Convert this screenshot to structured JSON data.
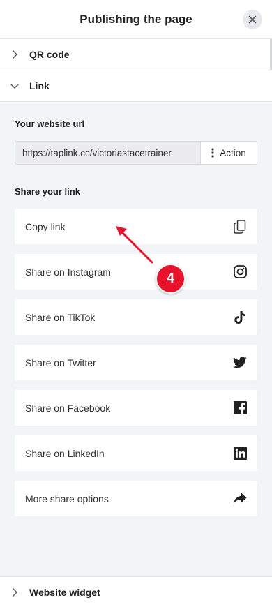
{
  "header": {
    "title": "Publishing the page"
  },
  "accordion": {
    "qr_label": "QR code",
    "link_label": "Link",
    "widget_label": "Website widget"
  },
  "link_panel": {
    "url_label": "Your website url",
    "url_value": "https://taplink.cc/victoriastacetrainer",
    "action_label": "Action",
    "share_label": "Share your link",
    "share_items": [
      {
        "label": "Copy link",
        "icon": "copy-icon"
      },
      {
        "label": "Share on Instagram",
        "icon": "instagram-icon"
      },
      {
        "label": "Share on TikTok",
        "icon": "tiktok-icon"
      },
      {
        "label": "Share on Twitter",
        "icon": "twitter-icon"
      },
      {
        "label": "Share on Facebook",
        "icon": "facebook-icon"
      },
      {
        "label": "Share on LinkedIn",
        "icon": "linkedin-icon"
      },
      {
        "label": "More share options",
        "icon": "share-arrow-icon"
      }
    ]
  },
  "annotation": {
    "step": "4",
    "color": "#e8132a"
  }
}
